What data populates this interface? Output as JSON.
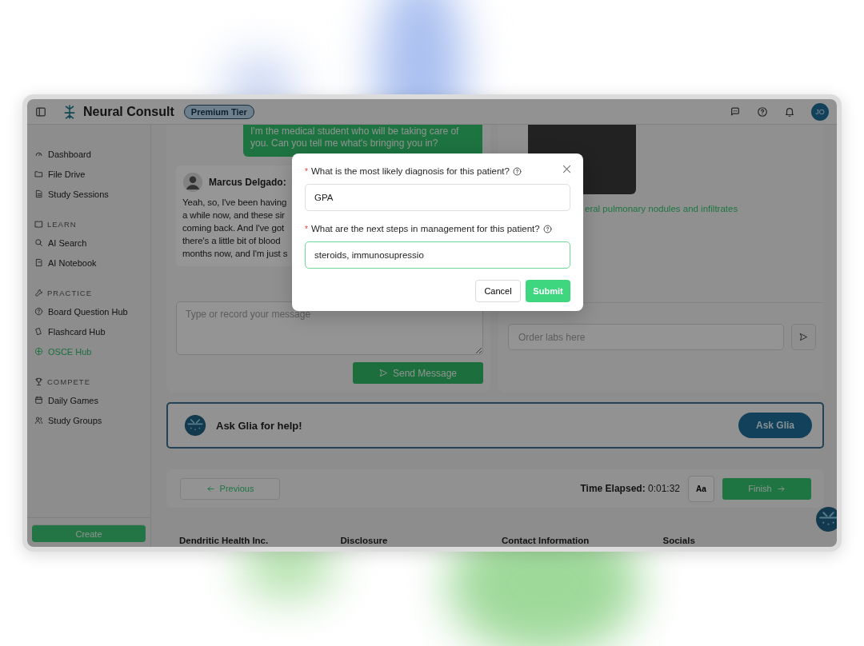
{
  "header": {
    "title": "Neural Consult",
    "badge": "Premium Tier",
    "avatar": "JO"
  },
  "sidebar": {
    "sections": [
      {
        "items": [
          {
            "label": "Dashboard",
            "selected": false
          },
          {
            "label": "File Drive",
            "selected": false
          },
          {
            "label": "Study Sessions",
            "selected": false
          }
        ]
      },
      {
        "heading": "LEARN",
        "items": [
          {
            "label": "AI Search",
            "selected": false
          },
          {
            "label": "AI Notebook",
            "selected": false
          }
        ]
      },
      {
        "heading": "PRACTICE",
        "items": [
          {
            "label": "Board Question Hub",
            "selected": false
          },
          {
            "label": "Flashcard Hub",
            "selected": false
          },
          {
            "label": "OSCE Hub",
            "selected": true
          }
        ]
      },
      {
        "heading": "COMPETE",
        "items": [
          {
            "label": "Daily Games",
            "selected": false
          },
          {
            "label": "Study Groups",
            "selected": false
          }
        ]
      }
    ],
    "create_button": "Create"
  },
  "chat": {
    "messages": [
      {
        "kind": "student",
        "text": "I'm the medical student who will be taking care of you. Can you tell me what's bringing you in?"
      },
      {
        "kind": "patient",
        "name": "Marcus Delgado:",
        "lines": [
          "Yeah, so, I've been having",
          "a while now, and these sir",
          "coming back. And I've got",
          "there's a little bit of blood",
          "months now, and I'm just s"
        ]
      }
    ],
    "input_placeholder": "Type or record your message",
    "send_button": "Send Message"
  },
  "results": {
    "image_caption": "eral pulmonary nodules and infiltrates",
    "labs_placeholder": "Order labs here"
  },
  "glia_banner": {
    "text": "Ask Glia for help!",
    "button": "Ask Glia"
  },
  "navigation": {
    "previous": "Previous",
    "time_label": "Time Elapsed:",
    "time_value": "0:01:32",
    "font_button": "Aa",
    "finish": "Finish"
  },
  "footer": {
    "headings": [
      "Dendritic Health Inc.",
      "Disclosure",
      "Contact Information",
      "Socials"
    ]
  },
  "modal": {
    "questions": [
      {
        "required_mark": "*",
        "label": "What is the most likely diagnosis for this patient?",
        "value": "GPA",
        "focused": false
      },
      {
        "required_mark": "*",
        "label": "What are the next steps in management for this patient?",
        "value": "steroids, immunosupressio",
        "focused": true
      }
    ],
    "cancel": "Cancel",
    "submit": "Submit"
  }
}
